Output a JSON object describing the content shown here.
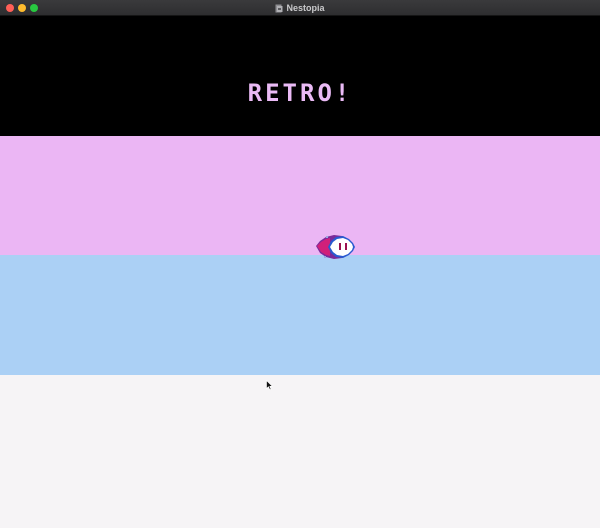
{
  "window": {
    "title": "Nestopia",
    "app_icon": "nestopia-app-icon"
  },
  "game_screen": {
    "headline": "RETRO!",
    "stripes": [
      "#000000",
      "#ebb6f4",
      "#abd0f5",
      "#f6f4f6"
    ],
    "headline_color": "#eabaf5",
    "sprite": "white-eye-fish-sprite"
  },
  "pointer": "arrow-cursor-icon"
}
